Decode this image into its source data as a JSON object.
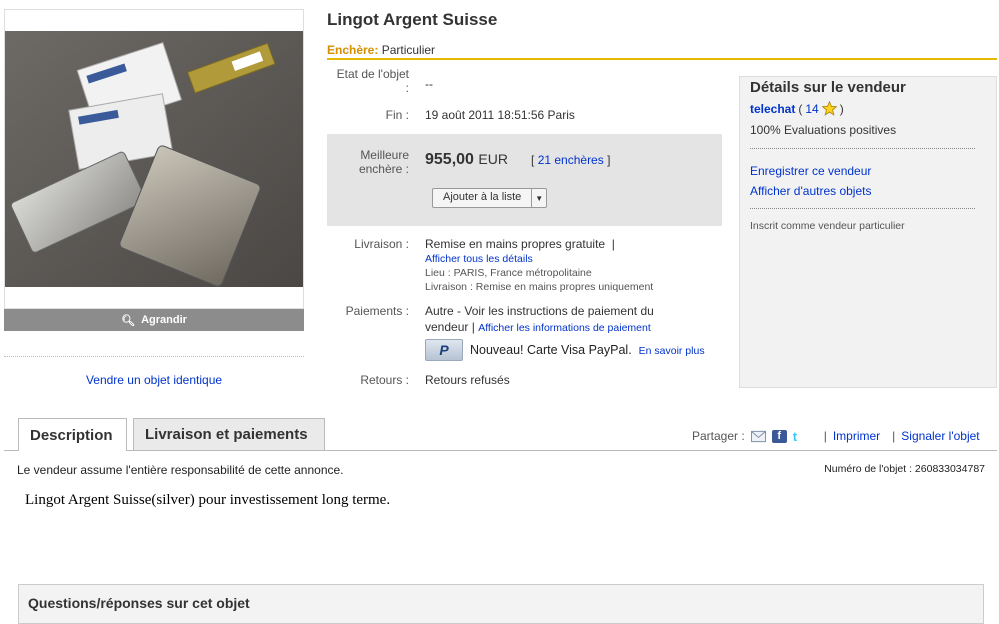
{
  "listing": {
    "title": "Lingot Argent Suisse",
    "auction_label": "Enchère:",
    "auction_type": "Particulier"
  },
  "image": {
    "enlarge_label": "Agrandir",
    "sell_similar": "Vendre un objet identique"
  },
  "details": {
    "condition_label": "Etat de l'objet",
    "condition_label2": ":",
    "condition_value": "--",
    "end_label": "Fin :",
    "end_value": "19 août 2011 18:51:56 Paris",
    "best_bid_label1": "Meilleure",
    "best_bid_label2": "enchère :",
    "price": "955,00",
    "currency": "EUR",
    "bids_open": "[",
    "bids_link": "21 enchères",
    "bids_close": "]",
    "watch_button": "Ajouter à la liste",
    "shipping_label": "Livraison :",
    "shipping_value": "Remise en mains propres gratuite",
    "shipping_sep": "|",
    "shipping_details_link": "Afficher tous les détails",
    "location": "Lieu : PARIS, France métropolitaine",
    "delivery": "Livraison : Remise en mains propres uniquement",
    "payment_label": "Paiements :",
    "payment_value1": "Autre - Voir les instructions de paiement du",
    "payment_value2": "vendeur",
    "payment_sep": "|",
    "payment_info_link": "Afficher les informations de paiement",
    "paypal_text": "Nouveau! Carte Visa PayPal.",
    "paypal_link": "En savoir plus",
    "returns_label": "Retours :",
    "returns_value": "Retours refusés"
  },
  "seller": {
    "heading": "Détails sur le vendeur",
    "name": "telechat",
    "feedback_open": "(",
    "feedback_score": "14",
    "feedback_close": ")",
    "positive": "100% Evaluations positives",
    "save_seller": "Enregistrer ce vendeur",
    "other_items": "Afficher d'autres objets",
    "registered": "Inscrit comme vendeur particulier"
  },
  "tabs": {
    "description": "Description",
    "shipping": "Livraison et paiements"
  },
  "share": {
    "label": "Partager :",
    "sep1": "|",
    "print": "Imprimer",
    "sep2": "|",
    "report": "Signaler l'objet"
  },
  "description": {
    "responsibility": "Le vendeur assume l'entière responsabilité de cette annonce.",
    "item_number": "Numéro de l'objet : 260833034787",
    "text": "Lingot Argent Suisse(silver) pour investissement long terme."
  },
  "qa": {
    "title": "Questions/réponses sur cet objet"
  },
  "colors": {
    "accent_gold": "#e5b800",
    "auction_orange": "#d58f00",
    "link_blue": "#0033cc"
  }
}
